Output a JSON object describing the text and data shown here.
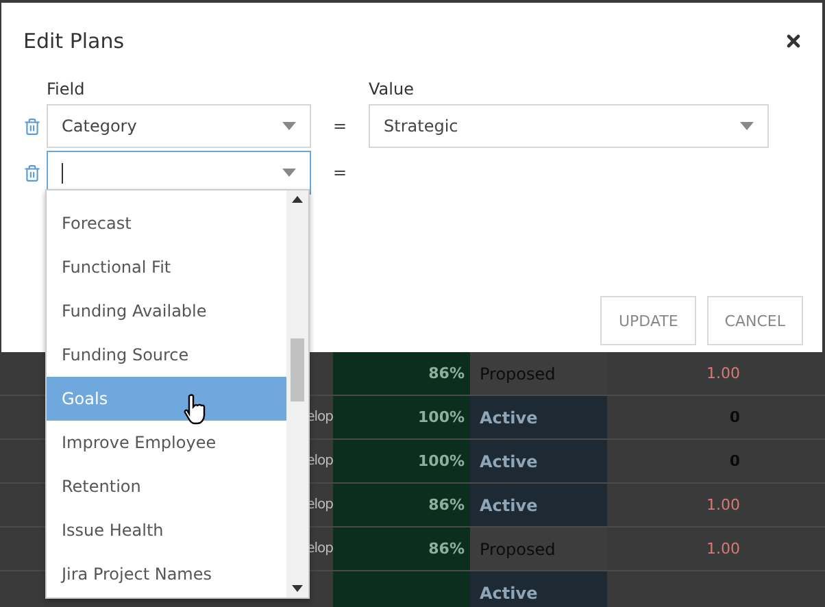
{
  "dialog": {
    "title": "Edit Plans",
    "labels": {
      "field": "Field",
      "value": "Value"
    },
    "filters": [
      {
        "field": "Category",
        "operator": "=",
        "value": "Strategic",
        "focused": false
      },
      {
        "operator": "=",
        "focused": true
      }
    ],
    "dropdown": {
      "options": [
        {
          "label": "Forecast",
          "selected": false
        },
        {
          "label": "Functional Fit",
          "selected": false
        },
        {
          "label": "Funding Available",
          "selected": false
        },
        {
          "label": "Funding Source",
          "selected": false
        },
        {
          "label": "Goals",
          "selected": true
        },
        {
          "label": "Improve Employee",
          "selected": false
        },
        {
          "label": "Retention",
          "selected": false
        },
        {
          "label": "Issue Health",
          "selected": false
        },
        {
          "label": "Jira Project Names",
          "selected": false
        }
      ]
    },
    "buttons": [
      "UPDATE",
      "CANCEL"
    ]
  },
  "table": {
    "rows": [
      {
        "percent": "86%",
        "status": "Proposed",
        "color": "#3d3d3d",
        "amount": "1.00",
        "flagged": true
      },
      {
        "column_1": "elop",
        "percent": "100%",
        "status": "Active",
        "color": "#1e2a33",
        "amount": "0",
        "flagged": false
      },
      {
        "column_1": "elop",
        "percent": "100%",
        "status": "Active",
        "color": "#1e2a33",
        "amount": "0",
        "flagged": false
      },
      {
        "column_1": "elop",
        "percent": "86%",
        "status": "Active",
        "color": "#1e2a33",
        "amount": "1.00",
        "flagged": true
      },
      {
        "column_1": "elop",
        "percent": "86%",
        "status": "Proposed",
        "color": "#3d3d3d",
        "amount": "1.00",
        "flagged": true
      },
      {
        "status": "Active",
        "color": "#1e2a33"
      }
    ]
  }
}
